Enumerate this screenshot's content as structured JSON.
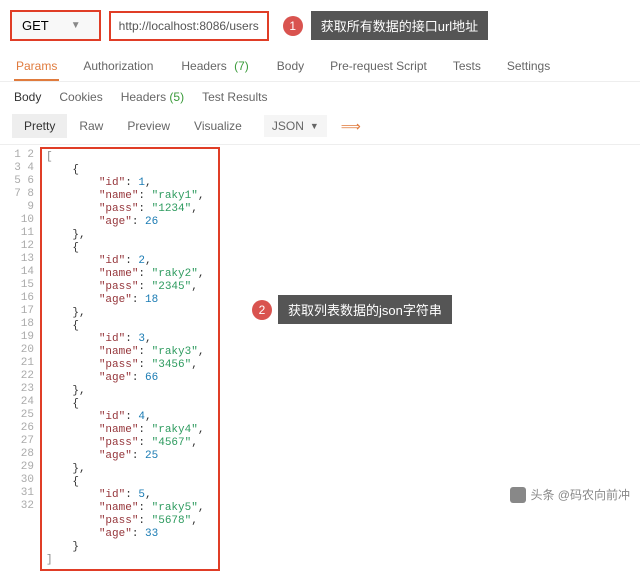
{
  "request": {
    "method": "GET",
    "url": "http://localhost:8086/users"
  },
  "callout1": {
    "num": "1",
    "text": "获取所有数据的接口url地址"
  },
  "callout2": {
    "num": "2",
    "text": "获取列表数据的json字符串"
  },
  "tabs1": {
    "params": "Params",
    "auth": "Authorization",
    "headers": "Headers",
    "headers_count": "(7)",
    "body": "Body",
    "prereq": "Pre-request Script",
    "tests": "Tests",
    "settings": "Settings"
  },
  "tabs2": {
    "body": "Body",
    "cookies": "Cookies",
    "headers": "Headers",
    "headers_count": "(5)",
    "testresults": "Test Results"
  },
  "viewbar": {
    "pretty": "Pretty",
    "raw": "Raw",
    "preview": "Preview",
    "visualize": "Visualize",
    "fmt": "JSON"
  },
  "chart_data": {
    "type": "table",
    "columns": [
      "id",
      "name",
      "pass",
      "age"
    ],
    "rows": [
      {
        "id": 1,
        "name": "raky1",
        "pass": "1234",
        "age": 26
      },
      {
        "id": 2,
        "name": "raky2",
        "pass": "2345",
        "age": 18
      },
      {
        "id": 3,
        "name": "raky3",
        "pass": "3456",
        "age": 66
      },
      {
        "id": 4,
        "name": "raky4",
        "pass": "4567",
        "age": 25
      },
      {
        "id": 5,
        "name": "raky5",
        "pass": "5678",
        "age": 33
      }
    ]
  },
  "watermark": "头条 @码农向前冲",
  "linecount": 32
}
